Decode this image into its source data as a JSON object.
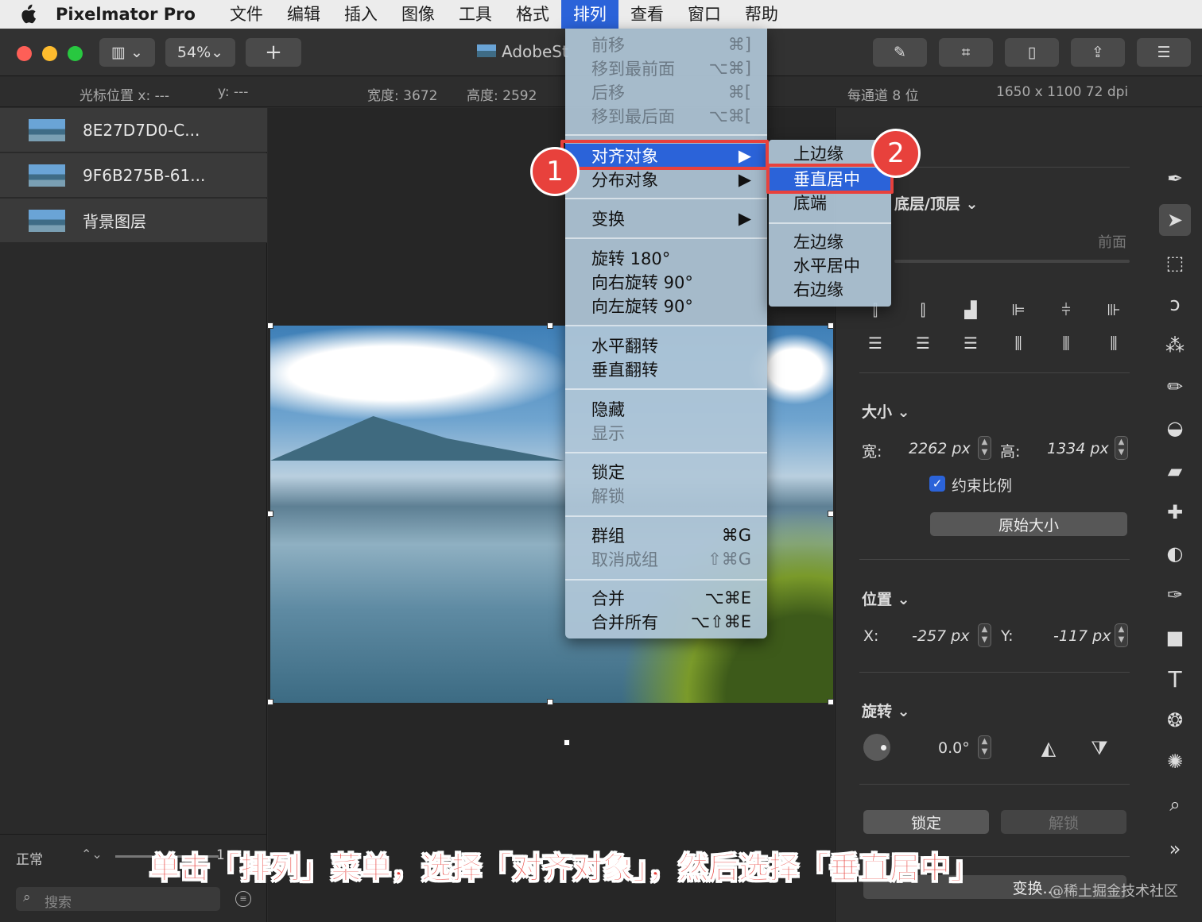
{
  "menubar": {
    "app": "Pixelmator Pro",
    "items": [
      "文件",
      "编辑",
      "插入",
      "图像",
      "工具",
      "格式",
      "排列",
      "查看",
      "窗口",
      "帮助"
    ],
    "active_index": 6
  },
  "toolbar": {
    "zoom": "54%",
    "add_label": "+",
    "doc_title": "AdobeSt"
  },
  "infobar": {
    "cursor_x": "光标位置 x:  ---",
    "cursor_y": "y:  ---",
    "width": "宽度: 3672",
    "height": "高度: 2592",
    "depth": "每通道 8 位",
    "dims": "1650 x 1100 72 dpi"
  },
  "layers": [
    {
      "name": "8E27D7D0-C..."
    },
    {
      "name": "9F6B275B-61..."
    },
    {
      "name": "背景图层"
    }
  ],
  "blend": {
    "mode": "正常",
    "opacity": "1"
  },
  "search": {
    "placeholder": "搜索"
  },
  "arrange_menu": {
    "items": [
      {
        "label": "前移",
        "shortcut": "⌘]",
        "disabled": true
      },
      {
        "label": "移到最前面",
        "shortcut": "⌥⌘]",
        "disabled": true
      },
      {
        "label": "后移",
        "shortcut": "⌘[",
        "disabled": true
      },
      {
        "label": "移到最后面",
        "shortcut": "⌥⌘[",
        "disabled": true
      },
      {
        "label": "对齐对象",
        "shortcut": "▶",
        "highlighted": true
      },
      {
        "label": "分布对象",
        "shortcut": "▶"
      },
      {
        "label": "变换",
        "shortcut": "▶"
      },
      {
        "label": "旋转 180°",
        "shortcut": ""
      },
      {
        "label": "向右旋转 90°",
        "shortcut": ""
      },
      {
        "label": "向左旋转 90°",
        "shortcut": ""
      },
      {
        "label": "水平翻转",
        "shortcut": ""
      },
      {
        "label": "垂直翻转",
        "shortcut": ""
      },
      {
        "label": "隐藏",
        "shortcut": ""
      },
      {
        "label": "显示",
        "shortcut": "",
        "disabled": true
      },
      {
        "label": "锁定",
        "shortcut": ""
      },
      {
        "label": "解锁",
        "shortcut": "",
        "disabled": true
      },
      {
        "label": "群组",
        "shortcut": "⌘G"
      },
      {
        "label": "取消成组",
        "shortcut": "⇧⌘G",
        "disabled": true
      },
      {
        "label": "合并",
        "shortcut": "⌥⌘E"
      },
      {
        "label": "合并所有",
        "shortcut": "⌥⇧⌘E"
      }
    ]
  },
  "align_submenu": {
    "items": [
      "上边缘",
      "垂直居中",
      "底端",
      "左边缘",
      "水平居中",
      "右边缘"
    ],
    "highlighted_index": 1
  },
  "badges": {
    "step1": "1",
    "step2": "2"
  },
  "inspector": {
    "arrange_label": "底层/顶层 ⌄",
    "front_label": "前面",
    "size_label": "大小 ⌄",
    "width_label": "宽:",
    "width_value": "2262 px",
    "height_label": "高:",
    "height_value": "1334 px",
    "constrain_label": "约束比例",
    "constrain_checked": true,
    "original_size": "原始大小",
    "position_label": "位置 ⌄",
    "x_label": "X:",
    "x_value": "-257 px",
    "y_label": "Y:",
    "y_value": "-117 px",
    "rotate_label": "旋转 ⌄",
    "rotate_value": "0.0°",
    "lock": "锁定",
    "unlock": "解锁",
    "replace": "变换..."
  },
  "caption": "单击「排列」菜单，选择「对齐对象」，然后选择「垂直居中」",
  "watermark": "@稀土掘金技术社区",
  "colors": {
    "highlight": "#2b63d9",
    "annotation": "#e8413c"
  }
}
